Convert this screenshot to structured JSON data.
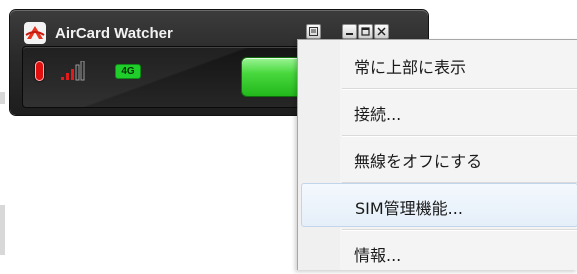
{
  "window": {
    "title": "AirCard Watcher",
    "buttons": {
      "options_icon": "options-icon",
      "minimize_icon": "minimize-icon",
      "maximize_icon": "maximize-icon",
      "close_icon": "close-icon"
    }
  },
  "status": {
    "battery_icon": "battery-icon",
    "signal_icon": "signal-strength-icon",
    "network_type": "4G",
    "connect_button_color": "#3ccf34"
  },
  "context_menu": {
    "items": [
      {
        "label": "常に上部に表示"
      },
      {
        "label": "接続..."
      },
      {
        "label": "無線をオフにする"
      },
      {
        "label": "SIM管理機能..."
      },
      {
        "label": "情報..."
      }
    ],
    "highlighted_index": 3
  },
  "colors": {
    "window_bg": "#2a2a2a",
    "battery": "#e20f0f",
    "signal": "#e11b1b",
    "network_badge": "#1fce2a",
    "menu_highlight": "#e5eff9"
  }
}
